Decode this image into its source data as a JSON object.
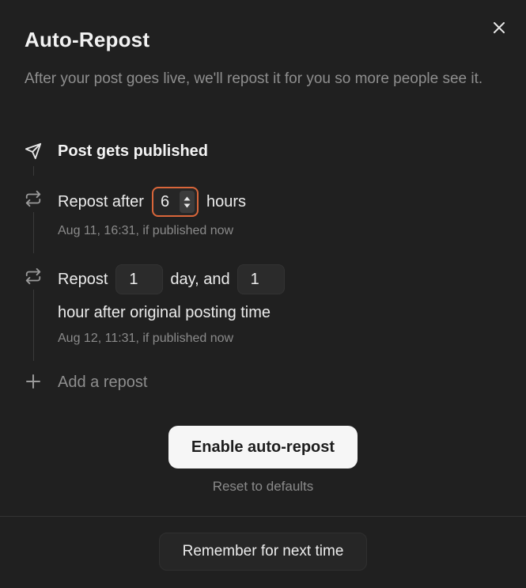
{
  "dialog": {
    "title": "Auto-Repost",
    "subtitle": "After your post goes live, we'll repost it for you so more people see it."
  },
  "timeline": {
    "published": {
      "label": "Post gets published",
      "icon": "send-icon"
    },
    "repost1": {
      "icon": "repeat-icon",
      "prefix": "Repost after",
      "hours_value": "6",
      "suffix": "hours",
      "note": "Aug 11, 16:31, if published now"
    },
    "repost2": {
      "icon": "repeat-icon",
      "prefix": "Repost",
      "days_value": "1",
      "middle": "day, and",
      "hours_value": "1",
      "suffix": "hour after original posting time",
      "note": "Aug 12, 11:31, if published now"
    },
    "add": {
      "label": "Add a repost",
      "icon": "plus-icon"
    }
  },
  "actions": {
    "enable_label": "Enable auto-repost",
    "reset_label": "Reset to defaults",
    "remember_label": "Remember for next time"
  },
  "colors": {
    "background": "#202020",
    "focus_border": "#d9663a",
    "primary_button": "#f6f6f6"
  }
}
